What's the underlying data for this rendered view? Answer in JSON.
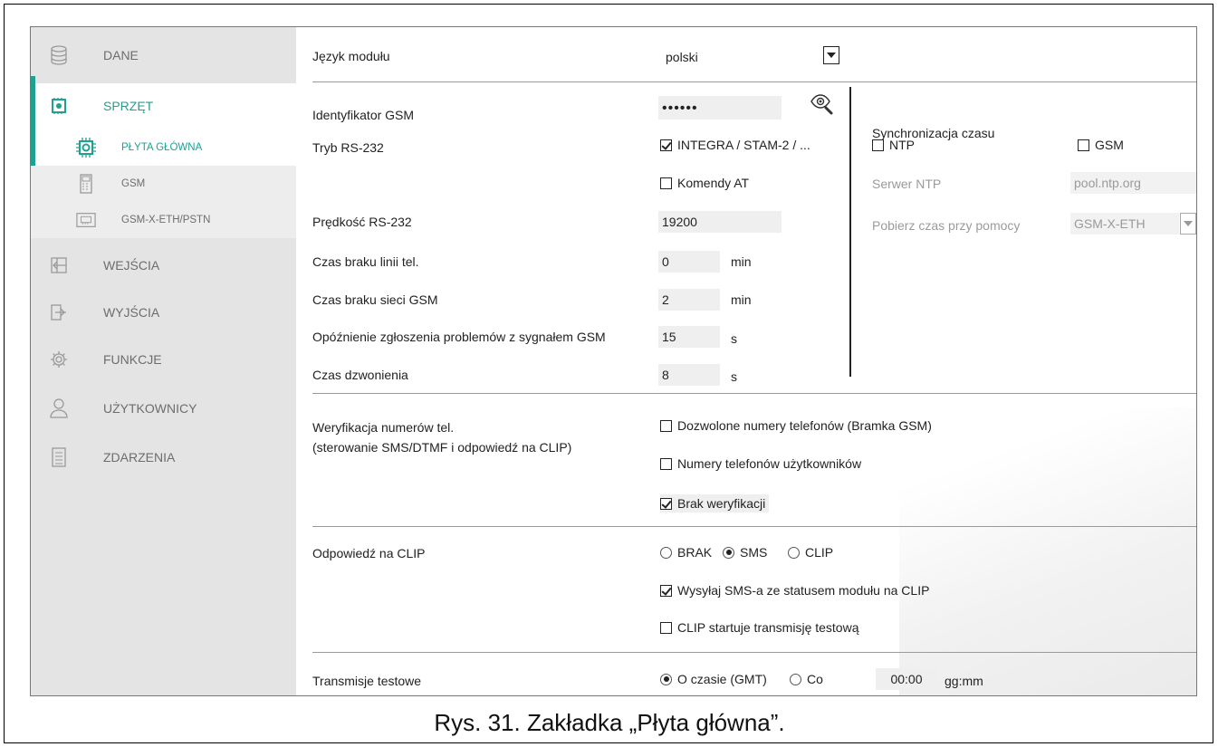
{
  "sidebar": {
    "items": [
      {
        "label": "DANE",
        "icon": "database-icon"
      },
      {
        "label": "SPRZĘT",
        "icon": "hardware-icon"
      },
      {
        "label": "PŁYTA GŁÓWNA",
        "icon": "mainboard-icon"
      },
      {
        "label": "GSM",
        "icon": "gsm-module-icon"
      },
      {
        "label": "GSM-X-ETH/PSTN",
        "icon": "eth-module-icon"
      },
      {
        "label": "WEJŚCIA",
        "icon": "inputs-icon"
      },
      {
        "label": "WYJŚCIA",
        "icon": "outputs-icon"
      },
      {
        "label": "FUNKCJE",
        "icon": "gear-icon"
      },
      {
        "label": "UŻYTKOWNICY",
        "icon": "user-icon"
      },
      {
        "label": "ZDARZENIA",
        "icon": "events-icon"
      }
    ]
  },
  "settings": {
    "language": {
      "label": "Język modułu",
      "value": "polski"
    },
    "gsm_id": {
      "label": "Identyfikator GSM",
      "value": "••••••"
    },
    "rs232_mode": {
      "label": "Tryb RS-232",
      "option1": "INTEGRA / STAM-2 / ...",
      "option2": "Komendy AT"
    },
    "rs232_speed": {
      "label": "Prędkość RS-232",
      "value": "19200"
    },
    "no_phone_line": {
      "label": "Czas braku linii tel.",
      "value": "0",
      "unit": "min"
    },
    "no_gsm": {
      "label": "Czas braku sieci GSM",
      "value": "2",
      "unit": "min"
    },
    "gsm_signal_delay": {
      "label": "Opóźnienie zgłoszenia problemów z sygnałem GSM",
      "value": "15",
      "unit": "s"
    },
    "ring_time": {
      "label": "Czas dzwonienia",
      "value": "8",
      "unit": "s"
    }
  },
  "time_sync": {
    "title": "Synchronizacja czasu",
    "ntp": "NTP",
    "gsm": "GSM",
    "ntp_server_label": "Serwer NTP",
    "ntp_server_value": "pool.ntp.org",
    "fetch_label": "Pobierz czas przy pomocy",
    "fetch_value": "GSM-X-ETH"
  },
  "verification": {
    "label1": "Weryfikacja numerów tel.",
    "label2": "(sterowanie SMS/DTMF i odpowiedź na CLIP)",
    "opt1": "Dozwolone numery telefonów (Bramka GSM)",
    "opt2": "Numery telefonów użytkowników",
    "opt3": "Brak weryfikacji"
  },
  "clip": {
    "label": "Odpowiedź na CLIP",
    "r1": "BRAK",
    "r2": "SMS",
    "r3": "CLIP",
    "opt1": "Wysyłaj SMS-a ze statusem modułu na CLIP",
    "opt2": "CLIP startuje transmisję testową"
  },
  "test_tx": {
    "label": "Transmisje testowe",
    "r1": "O czasie (GMT)",
    "r2": "Co",
    "time": "00:00",
    "format": "gg:mm"
  },
  "caption": "Rys. 31. Zakładka „Płyta główna”.",
  "colors": {
    "accent": "#20a090",
    "sidebar_bg": "#e4e4e4"
  }
}
